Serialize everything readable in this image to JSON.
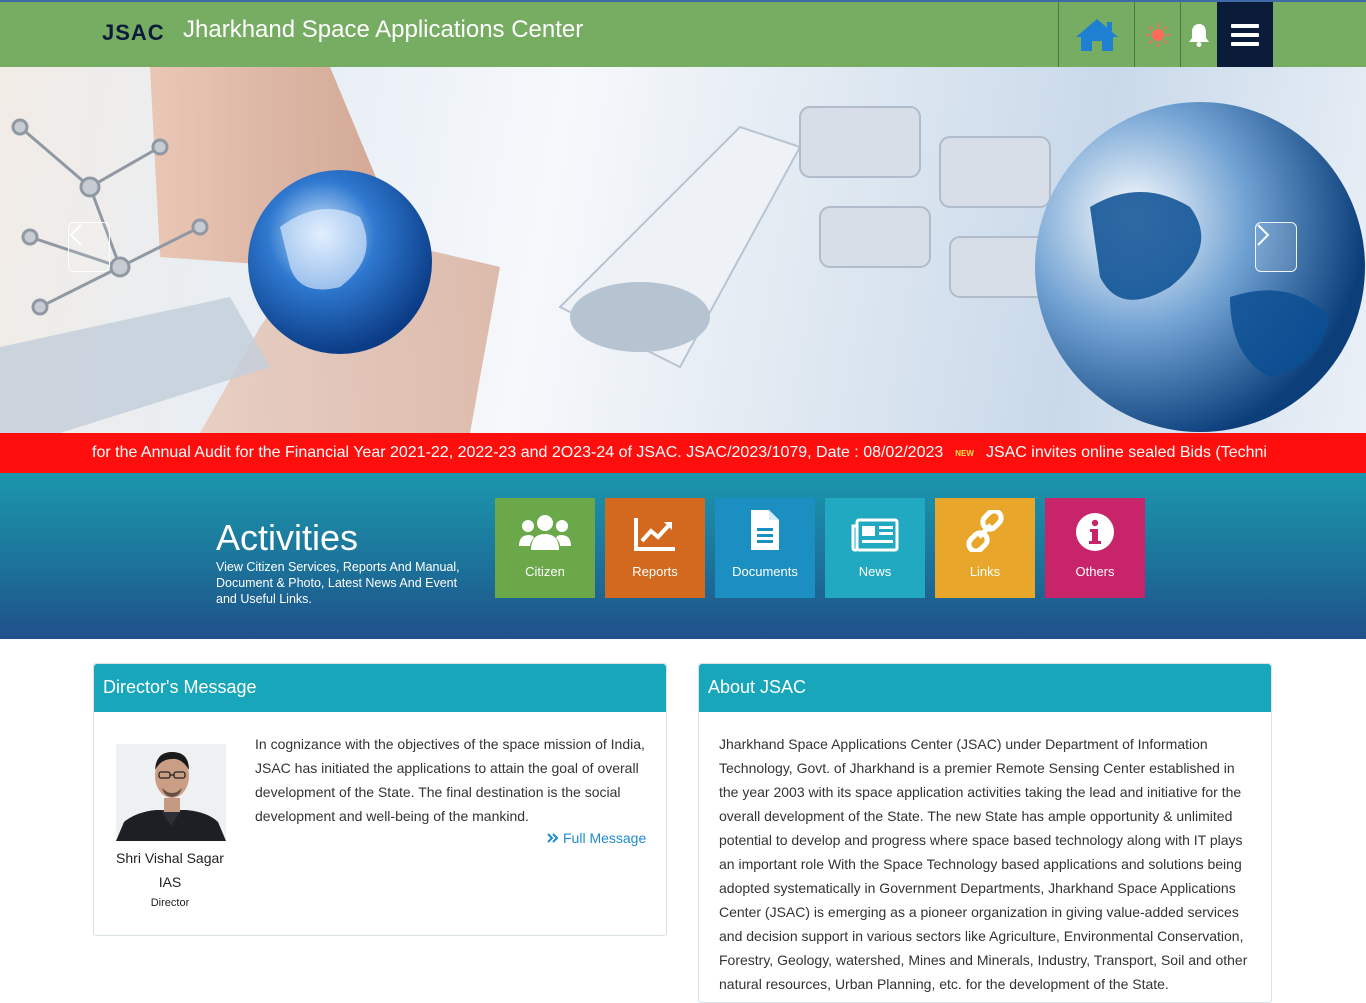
{
  "header": {
    "logo_text": "JSAC",
    "title": "Jharkhand Space Applications Center",
    "icons": [
      "home-icon",
      "sun-icon",
      "bell-icon",
      "hamburger-menu-icon"
    ]
  },
  "ticker": {
    "text_1": "for the Annual Audit for the Financial Year 2021-22, 2022-23 and 2O23-24 of JSAC. JSAC/2023/1079, Date : 08/02/2023",
    "badge": "NEW",
    "text_2": "JSAC invites online sealed Bids (Techni"
  },
  "activities": {
    "title": "Activities",
    "description": "View Citizen Services, Reports And Manual, Document & Photo, Latest News And Event and Useful Links.",
    "tiles": [
      {
        "label": "Citizen",
        "icon": "users-icon",
        "color": "#6aa84a"
      },
      {
        "label": "Reports",
        "icon": "chart-icon",
        "color": "#d2691e"
      },
      {
        "label": "Documents",
        "icon": "document-icon",
        "color": "#1b8fc2"
      },
      {
        "label": "News",
        "icon": "newspaper-icon",
        "color": "#22a9c2"
      },
      {
        "label": "Links",
        "icon": "link-icon",
        "color": "#e8a72a"
      },
      {
        "label": "Others",
        "icon": "info-icon",
        "color": "#c7246a"
      }
    ]
  },
  "director": {
    "heading": "Director's Message",
    "name": "Shri Vishal Sagar",
    "suffix": "IAS",
    "role": "Director",
    "message": "In cognizance with the objectives of the space mission of India, JSAC has initiated the applications to attain the goal of overall development of the State. The final destination is the social development and well-being of the mankind.",
    "link": "Full Message"
  },
  "about": {
    "heading": "About JSAC",
    "text": "Jharkhand Space Applications Center (JSAC) under Department of Information Technology, Govt. of Jharkhand is a premier Remote Sensing Center established in the year 2003 with its space application activities taking the lead and initiative for the overall development of the State. The new State has ample opportunity & unlimited potential to develop and progress where space based technology along with IT plays an important role With the Space Technology based applications and solutions being adopted systematically in Government Departments, Jharkhand Space Applications Center (JSAC) is emerging as a pioneer organization in giving value-added services and decision support in various sectors like Agriculture, Environmental Conservation, Forestry, Geology, watershed, Mines and Minerals, Industry, Transport, Soil and other natural resources, Urban Planning, etc. for the development of the State."
  }
}
